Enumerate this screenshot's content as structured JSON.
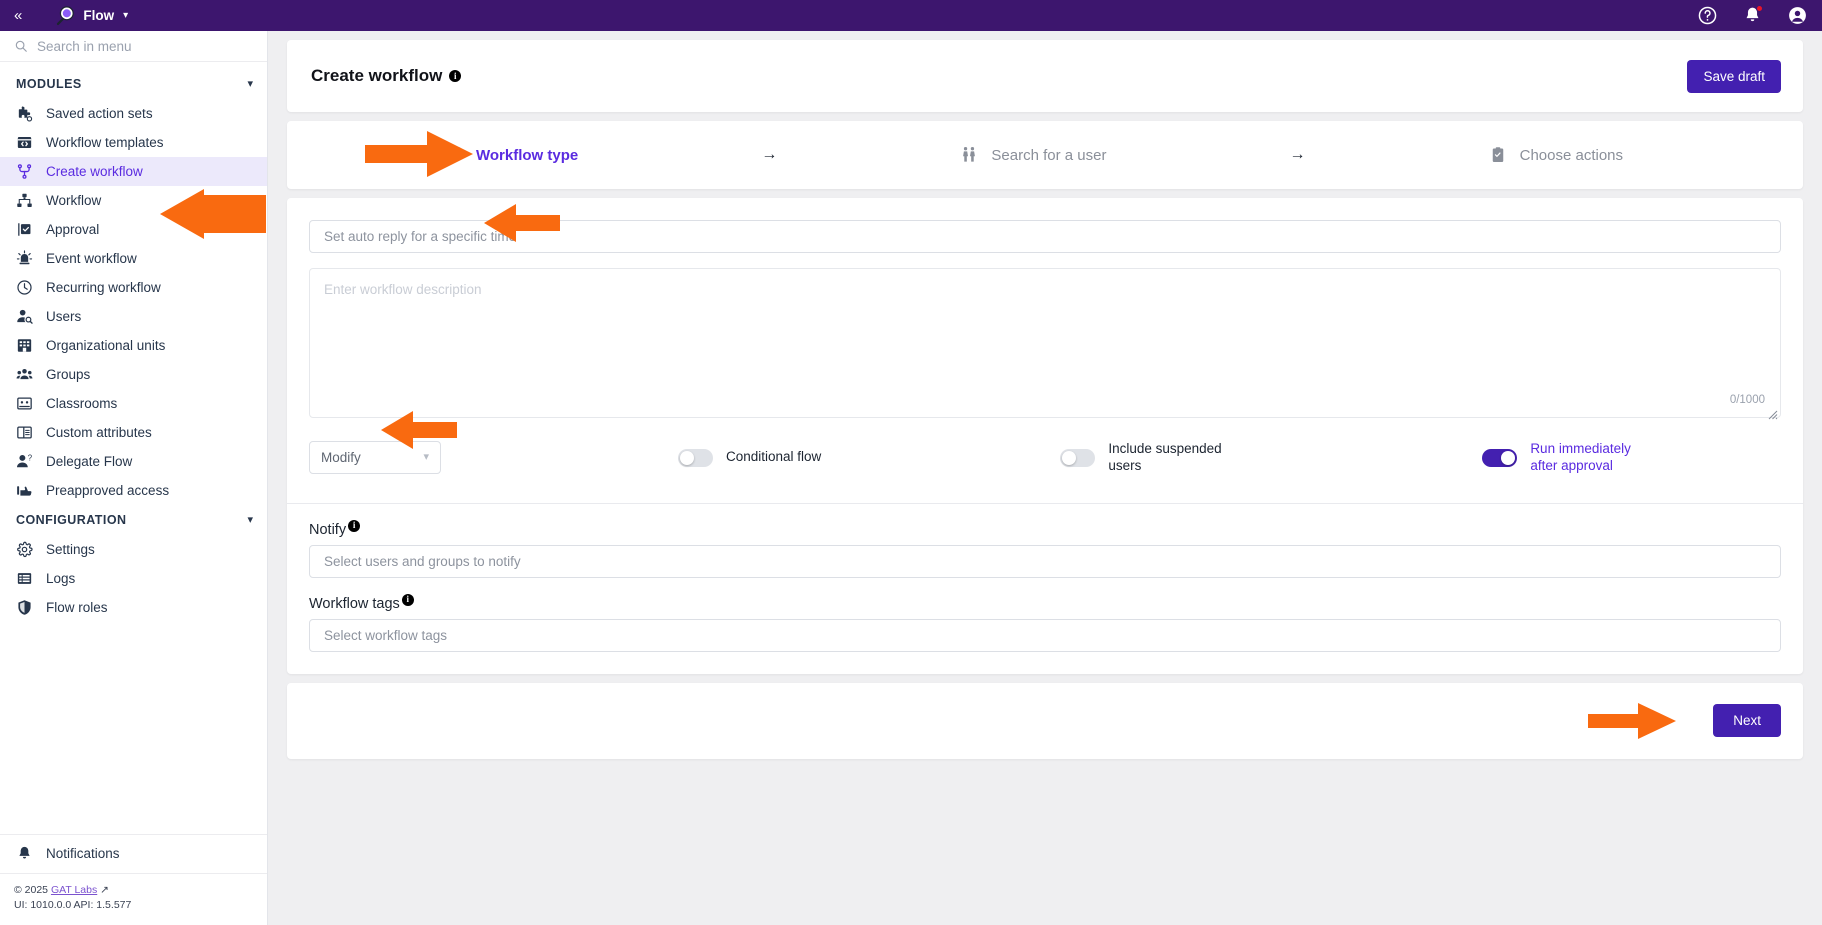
{
  "topbar": {
    "collapse_icon": "double-chevron-left-icon",
    "brand_name": "Flow",
    "brand_logo_icon": "flow-magnifier-logo",
    "brand_caret_icon": "chevron-down-icon",
    "help_icon": "help-circle-icon",
    "notifications_icon": "bell-icon",
    "account_icon": "account-circle-icon",
    "bg_color": "#3d166e"
  },
  "sidebar": {
    "search": {
      "placeholder": "Search in menu",
      "value": "",
      "icon": "search-icon"
    },
    "modules_section": {
      "title": "MODULES",
      "caret_icon": "chevron-down-icon",
      "items": [
        {
          "label": "Saved action sets",
          "icon": "puzzle-icon",
          "active": false
        },
        {
          "label": "Workflow templates",
          "icon": "code-window-icon",
          "active": false
        },
        {
          "label": "Create workflow",
          "icon": "branch-icon",
          "active": true
        },
        {
          "label": "Workflow",
          "icon": "hierarchy-icon",
          "active": false
        },
        {
          "label": "Approval",
          "icon": "approval-check-icon",
          "active": false
        },
        {
          "label": "Event workflow",
          "icon": "alarm-light-icon",
          "active": false
        },
        {
          "label": "Recurring workflow",
          "icon": "clock-icon",
          "active": false
        },
        {
          "label": "Users",
          "icon": "user-search-icon",
          "active": false
        },
        {
          "label": "Organizational units",
          "icon": "building-icon",
          "active": false
        },
        {
          "label": "Groups",
          "icon": "group-icon",
          "active": false
        },
        {
          "label": "Classrooms",
          "icon": "classroom-icon",
          "active": false
        },
        {
          "label": "Custom attributes",
          "icon": "columns-icon",
          "active": false
        },
        {
          "label": "Delegate Flow",
          "icon": "user-question-icon",
          "active": false
        },
        {
          "label": "Preapproved access",
          "icon": "hand-access-icon",
          "active": false
        }
      ]
    },
    "configuration_section": {
      "title": "CONFIGURATION",
      "caret_icon": "chevron-down-icon",
      "items": [
        {
          "label": "Settings",
          "icon": "gear-icon",
          "active": false
        },
        {
          "label": "Logs",
          "icon": "list-icon",
          "active": false
        },
        {
          "label": "Flow roles",
          "icon": "shield-icon",
          "active": false
        }
      ]
    },
    "notifications": {
      "label": "Notifications",
      "icon": "bell-icon"
    },
    "footer": {
      "copyright": "© 2025 ",
      "link_text": "GAT Labs",
      "external_icon": "external-link-icon",
      "version": "UI: 1010.0.0 API: 1.5.577"
    }
  },
  "main": {
    "header": {
      "title": "Create workflow",
      "title_info_icon": "info-icon",
      "save_draft_label": "Save draft"
    },
    "stepper": {
      "arrow_icon": "arrow-right-icon",
      "steps": [
        {
          "label": "Workflow type",
          "icon": "branch-icon",
          "active": true
        },
        {
          "label": "Search for a user",
          "icon": "people-icon",
          "active": false
        },
        {
          "label": "Choose actions",
          "icon": "clipboard-icon",
          "active": false
        }
      ]
    },
    "form": {
      "name_field": {
        "value": "",
        "placeholder": "Set auto reply for a specific time"
      },
      "description_field": {
        "value": "",
        "placeholder": "Enter workflow description",
        "counter": "0/1000"
      },
      "action_select": {
        "value": "Modify",
        "caret_icon": "chevron-down-icon"
      },
      "toggles": [
        {
          "label": "Conditional flow",
          "on": false
        },
        {
          "label": "Include suspended users",
          "on": true,
          "state_on": false
        },
        {
          "label": "Run immediately after approval",
          "on": true
        }
      ],
      "notify": {
        "label": "Notify",
        "info_icon": "info-icon",
        "placeholder": "Select users and groups to notify",
        "value": ""
      },
      "workflow_tags": {
        "label": "Workflow tags",
        "info_icon": "info-icon",
        "placeholder": "Select workflow tags",
        "value": ""
      }
    },
    "footer": {
      "next_label": "Next"
    }
  },
  "annotations": {
    "arrow_color": "#f96a10",
    "arrows": [
      {
        "name": "arrow-to-create-workflow",
        "direction": "left"
      },
      {
        "name": "arrow-to-workflow-type-step",
        "direction": "right"
      },
      {
        "name": "arrow-to-name-field",
        "direction": "left"
      },
      {
        "name": "arrow-to-action-select",
        "direction": "left"
      },
      {
        "name": "arrow-to-next-button",
        "direction": "right"
      }
    ]
  }
}
